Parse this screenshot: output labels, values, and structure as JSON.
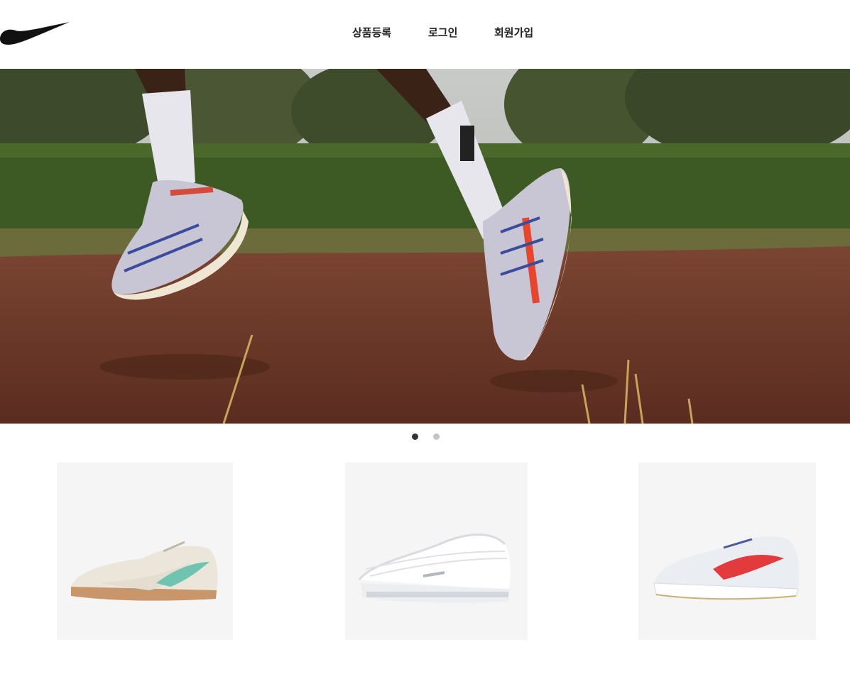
{
  "header": {
    "logo_icon": "nike-swoosh-icon",
    "nav": [
      {
        "label": "상품등록"
      },
      {
        "label": "로그인"
      },
      {
        "label": "회원가입"
      }
    ]
  },
  "hero": {
    "image": "runner-legs-mid-air-in-nike-running-shoes",
    "slides_total": 2,
    "active_slide": 1
  },
  "products": [
    {
      "image": "cream-sneaker-teal-swoosh-gum-sole"
    },
    {
      "image": "white-air-max-97"
    },
    {
      "image": "white-running-shoe-red-swoosh"
    }
  ],
  "colors": {
    "background": "#ffffff",
    "text": "#222222",
    "card_bg": "#f5f5f5",
    "dot_active": "#333333",
    "dot_inactive": "#c4c4c4"
  }
}
